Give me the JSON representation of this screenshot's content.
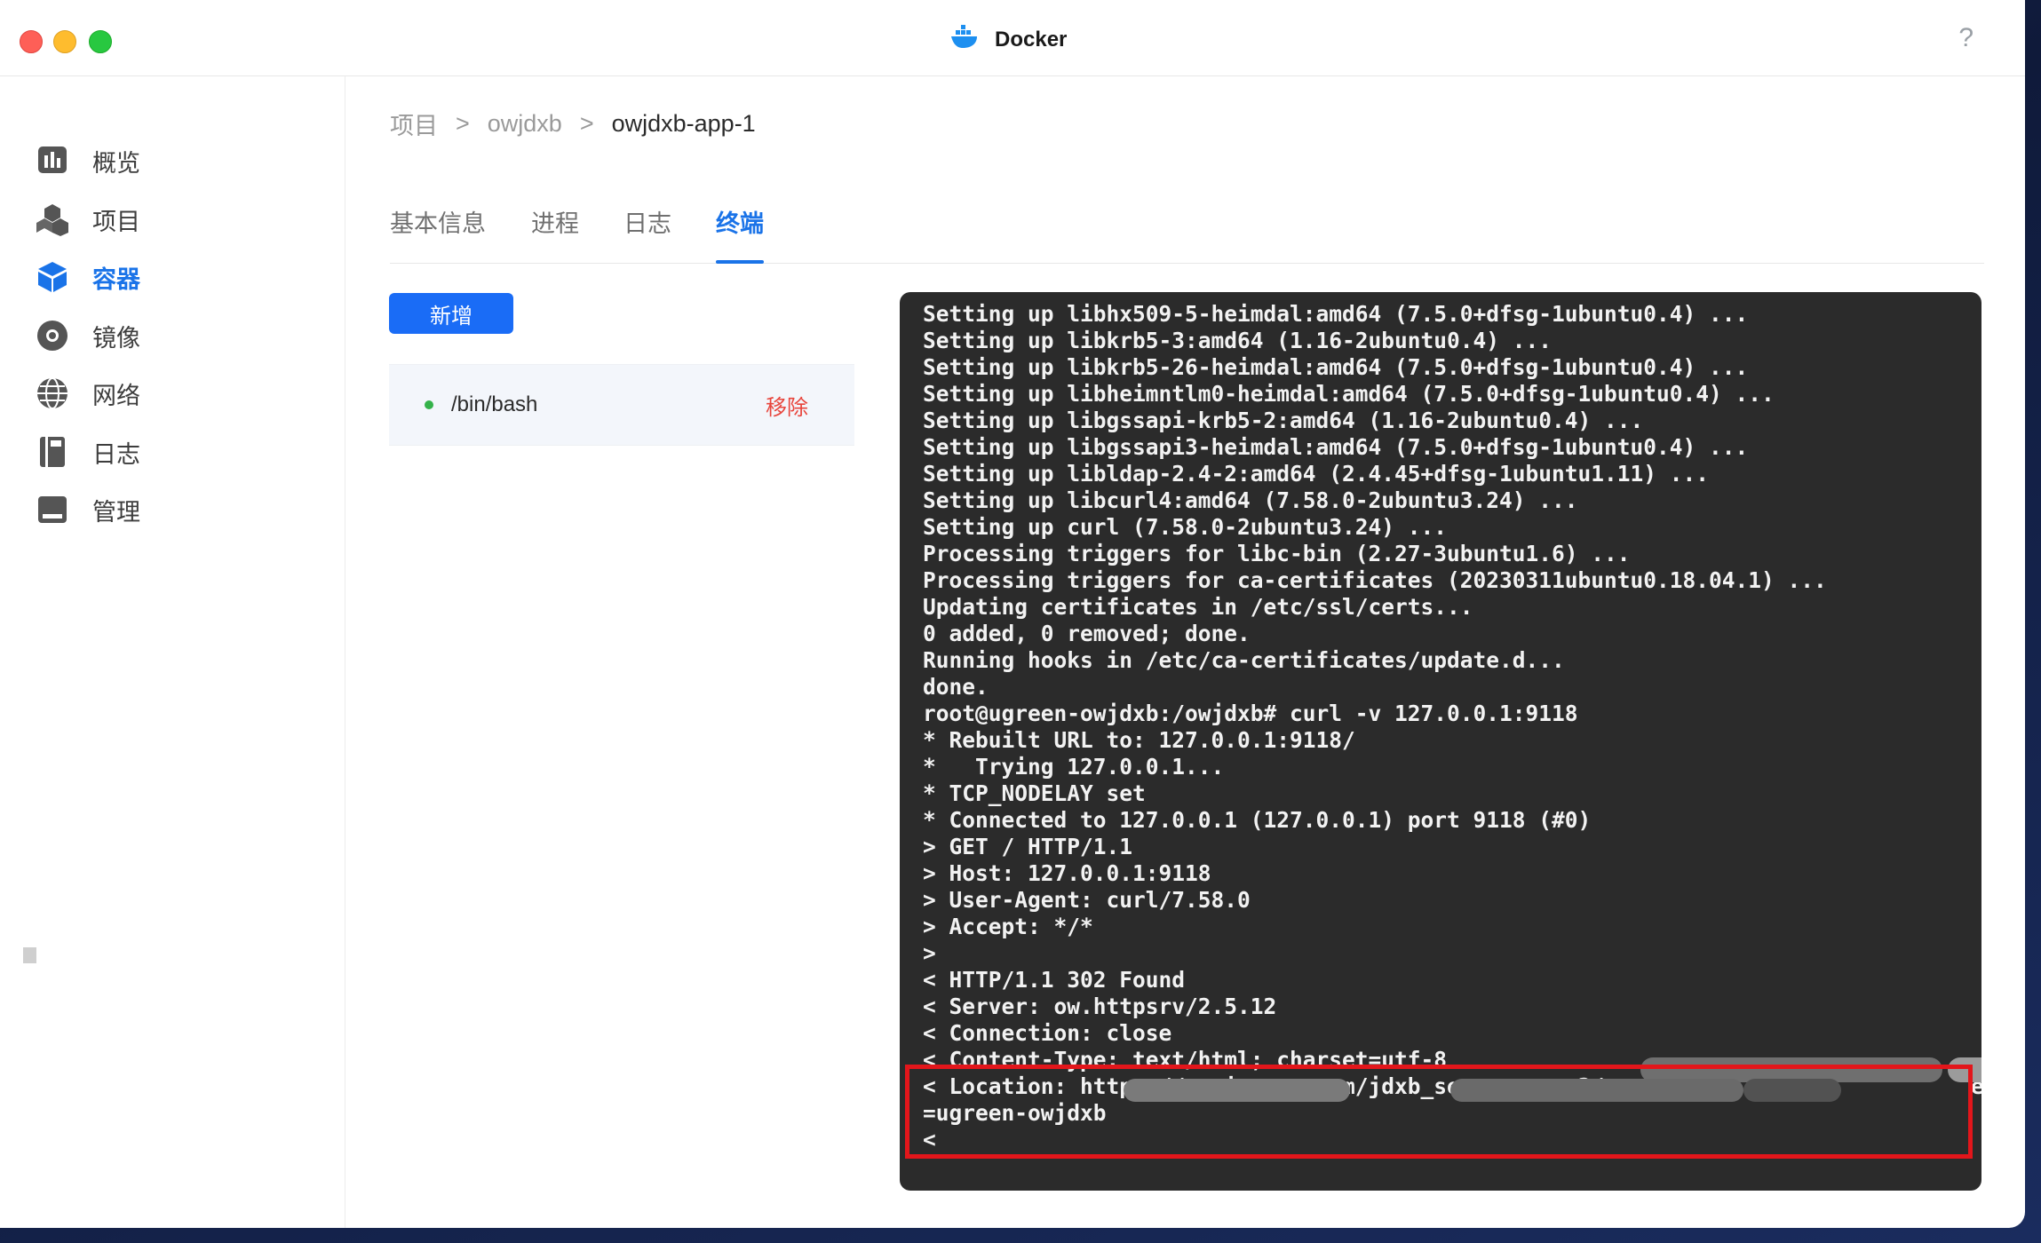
{
  "window": {
    "title": "Docker",
    "help_label": "?"
  },
  "sidebar": {
    "items": [
      {
        "label": "概览",
        "icon": "overview-chart-icon"
      },
      {
        "label": "项目",
        "icon": "project-cubes-icon"
      },
      {
        "label": "容器",
        "icon": "container-box-icon"
      },
      {
        "label": "镜像",
        "icon": "image-disc-icon"
      },
      {
        "label": "网络",
        "icon": "network-globe-icon"
      },
      {
        "label": "日志",
        "icon": "log-book-icon"
      },
      {
        "label": "管理",
        "icon": "manage-panel-icon"
      }
    ],
    "active_index": 2
  },
  "breadcrumb": {
    "root": "项目",
    "separator": ">",
    "project": "owjdxb",
    "current": "owjdxb-app-1"
  },
  "tabs": [
    {
      "label": "基本信息"
    },
    {
      "label": "进程"
    },
    {
      "label": "日志"
    },
    {
      "label": "终端"
    }
  ],
  "active_tab": 3,
  "add_button_label": "新增",
  "session": {
    "name": "/bin/bash",
    "remove_label": "移除",
    "status_color": "#34b24a"
  },
  "terminal": {
    "lines": [
      "Setting up libhx509-5-heimdal:amd64 (7.5.0+dfsg-1ubuntu0.4) ...",
      "Setting up libkrb5-3:amd64 (1.16-2ubuntu0.4) ...",
      "Setting up libkrb5-26-heimdal:amd64 (7.5.0+dfsg-1ubuntu0.4) ...",
      "Setting up libheimntlm0-heimdal:amd64 (7.5.0+dfsg-1ubuntu0.4) ...",
      "Setting up libgssapi-krb5-2:amd64 (1.16-2ubuntu0.4) ...",
      "Setting up libgssapi3-heimdal:amd64 (7.5.0+dfsg-1ubuntu0.4) ...",
      "Setting up libldap-2.4-2:amd64 (2.4.45+dfsg-1ubuntu1.11) ...",
      "Setting up libcurl4:amd64 (7.58.0-2ubuntu3.24) ...",
      "Setting up curl (7.58.0-2ubuntu3.24) ...",
      "Processing triggers for libc-bin (2.27-3ubuntu1.6) ...",
      "Processing triggers for ca-certificates (20230311ubuntu0.18.04.1) ...",
      "Updating certificates in /etc/ssl/certs...",
      "0 added, 0 removed; done.",
      "Running hooks in /etc/ca-certificates/update.d...",
      "done.",
      "root@ugreen-owjdxb:/owjdxb# curl -v 127.0.0.1:9118",
      "* Rebuilt URL to: 127.0.0.1:9118/",
      "*   Trying 127.0.0.1...",
      "* TCP_NODELAY set",
      "* Connected to 127.0.0.1 (127.0.0.1) port 9118 (#0)",
      "> GET / HTTP/1.1",
      "> Host: 127.0.0.1:9118",
      "> User-Agent: curl/7.58.0",
      "> Accept: */*",
      ">",
      "< HTTP/1.1 302 Found",
      "< Server: ow.httpsrv/2.5.12",
      "< Connection: close",
      "< Content-Type: text/html; charset=utf-8",
      "< Location: https://yc.ionewu.com/jdxb_server_pc_v3/                            e",
      "=ugreen-owjdxb",
      "<"
    ]
  },
  "colors": {
    "accent": "#1a73e8",
    "button_blue": "#1a6cf6",
    "danger": "#e8453c",
    "terminal_bg": "#2b2b2b",
    "highlight_red": "#e3161b"
  }
}
